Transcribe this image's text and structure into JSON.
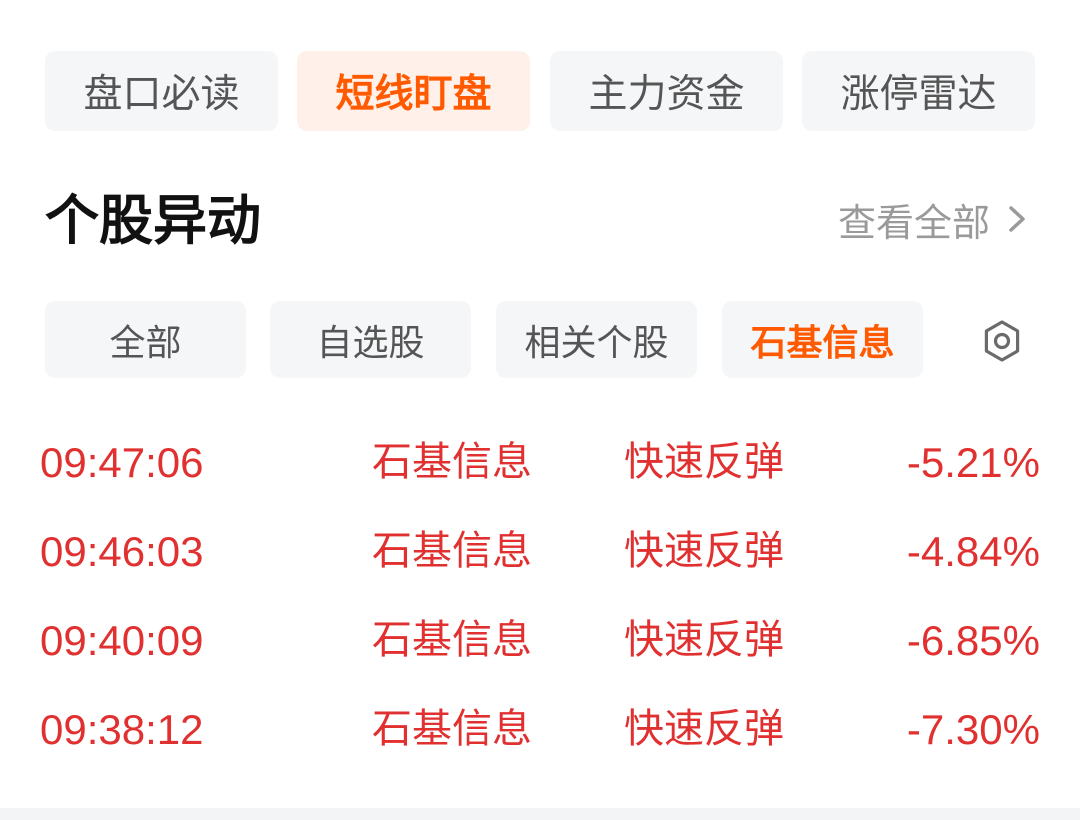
{
  "top_tabs": [
    {
      "label": "盘口必读",
      "active": false
    },
    {
      "label": "短线盯盘",
      "active": true
    },
    {
      "label": "主力资金",
      "active": false
    },
    {
      "label": "涨停雷达",
      "active": false
    }
  ],
  "section": {
    "title": "个股异动",
    "view_all_label": "查看全部"
  },
  "sub_tabs": [
    {
      "label": "全部",
      "active": false
    },
    {
      "label": "自选股",
      "active": false
    },
    {
      "label": "相关个股",
      "active": false
    },
    {
      "label": "石基信息",
      "active": true
    }
  ],
  "icons": {
    "settings": "gear-icon",
    "view_all": "chevron-right-icon"
  },
  "colors": {
    "accent": "#ff5a00",
    "down_red": "#e03030",
    "tab_bg": "#f5f6f8",
    "active_tab_bg": "#fff1ea"
  },
  "alerts": [
    {
      "time": "09:47:06",
      "stock": "石基信息",
      "event": "快速反弹",
      "change": "-5.21%"
    },
    {
      "time": "09:46:03",
      "stock": "石基信息",
      "event": "快速反弹",
      "change": "-4.84%"
    },
    {
      "time": "09:40:09",
      "stock": "石基信息",
      "event": "快速反弹",
      "change": "-6.85%"
    },
    {
      "time": "09:38:12",
      "stock": "石基信息",
      "event": "快速反弹",
      "change": "-7.30%"
    }
  ]
}
